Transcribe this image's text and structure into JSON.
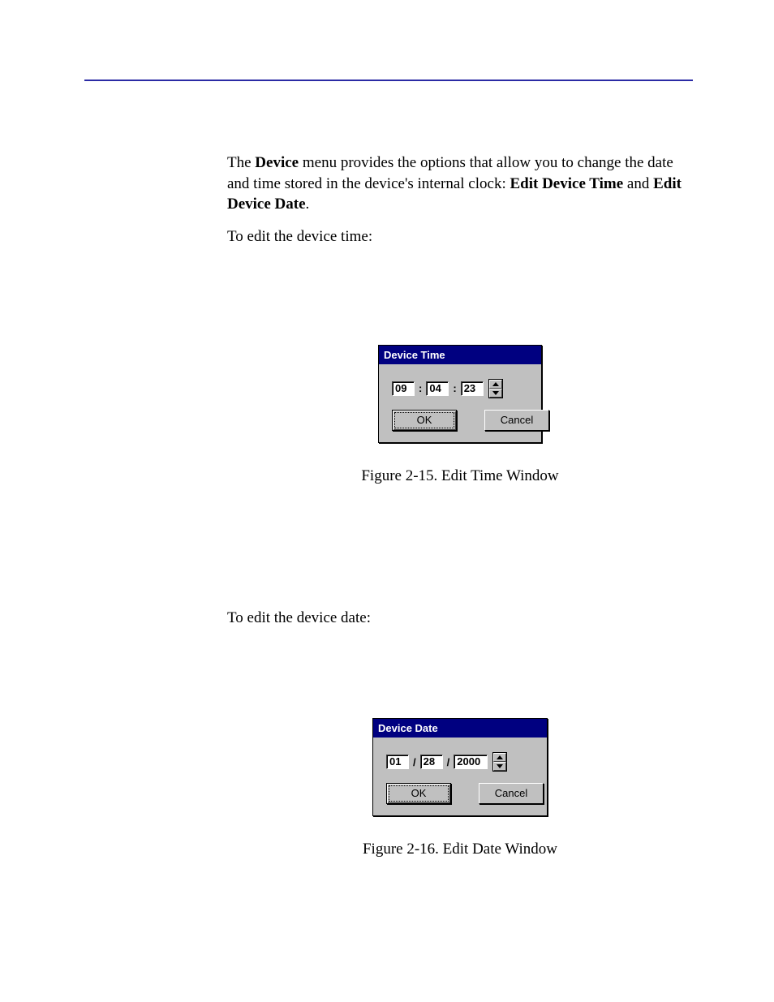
{
  "body": {
    "para1_pre": "The ",
    "para1_b1": "Device",
    "para1_mid": " menu provides the options that allow you to change the date and time stored in the device's internal clock: ",
    "para1_b2": "Edit Device Time",
    "para1_and": " and ",
    "para1_b3": "Edit Device Date",
    "para1_post": ".",
    "para2": "To edit the device time:",
    "para3": "To edit the device date:"
  },
  "fig1": {
    "caption": "Figure 2-15.  Edit Time Window",
    "win": {
      "title": "Device Time",
      "hh": "09",
      "mm": "04",
      "ss": "23",
      "sep": ":",
      "ok": "OK",
      "cancel": "Cancel"
    }
  },
  "fig2": {
    "caption": "Figure 2-16.  Edit Date Window",
    "win": {
      "title": "Device Date",
      "mm": "01",
      "dd": "28",
      "yyyy": "2000",
      "sep": "/",
      "ok": "OK",
      "cancel": "Cancel"
    }
  }
}
